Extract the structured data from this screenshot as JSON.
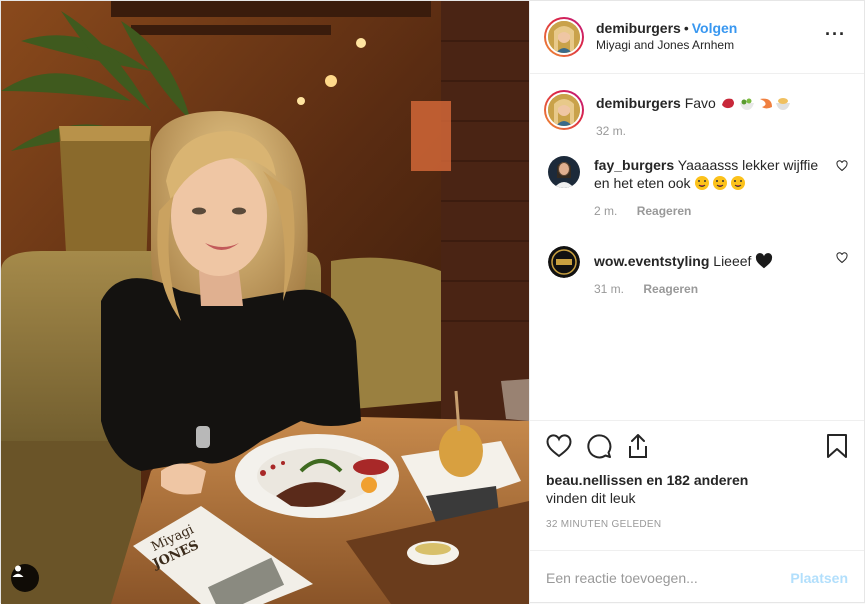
{
  "photo": {
    "alt_icon": "user-tag-icon",
    "menu_text_line1": "Miyagi",
    "menu_text_line2": "JONES"
  },
  "header": {
    "username": "demiburgers",
    "separator": "•",
    "follow_label": "Volgen",
    "location": "Miyagi and Jones Arnhem",
    "more_icon": "ellipsis-icon",
    "more_glyph": "···"
  },
  "caption": {
    "username": "demiburgers",
    "text": "Favo",
    "emojis": [
      "meat-emoji",
      "salad-emoji",
      "shrimp-emoji",
      "bowl-emoji"
    ],
    "time": "32 m."
  },
  "comments": [
    {
      "username": "fay_burgers",
      "text": "Yaaaasss lekker wijffie en het eten ook",
      "emojis": [
        "tongue-face-emoji",
        "tongue-face-emoji",
        "tongue-face-emoji"
      ],
      "time": "2 m.",
      "reply_label": "Reageren"
    },
    {
      "username": "wow.eventstyling",
      "text": "Lieeef",
      "emojis": [
        "black-heart-emoji"
      ],
      "time": "31 m.",
      "reply_label": "Reageren"
    }
  ],
  "actions": {
    "icons": [
      "heart-icon",
      "comment-icon",
      "share-icon",
      "bookmark-icon"
    ],
    "likes_user": "beau.nellissen",
    "likes_rest": "en 182 anderen",
    "likes_suffix": "vinden dit leuk",
    "time_ago": "32 MINUTEN GELEDEN"
  },
  "add_comment": {
    "placeholder": "Een reactie toevoegen...",
    "post_label": "Plaatsen"
  },
  "colors": {
    "accent": "#3897f0",
    "post_disabled": "#b2dffc",
    "muted": "#999999",
    "text": "#262626"
  }
}
